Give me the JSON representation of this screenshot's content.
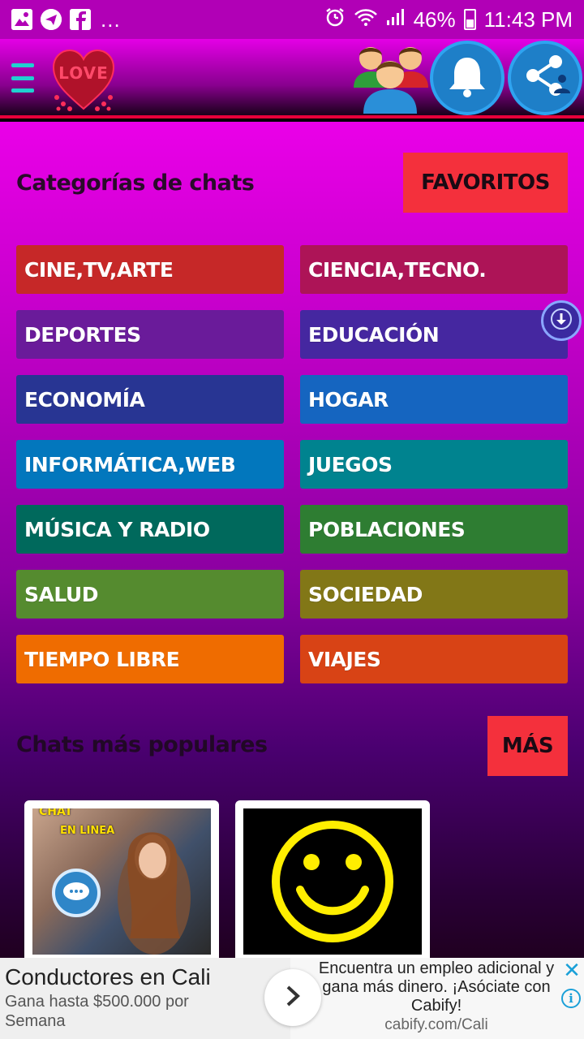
{
  "status_bar": {
    "icons_left": [
      "gallery-icon",
      "telegram-icon",
      "facebook-icon"
    ],
    "more": "...",
    "battery": "46%",
    "time": "11:43 PM"
  },
  "app_bar": {
    "logo_text": "LOVE",
    "icons": [
      "menu-icon",
      "users-icon",
      "bell-icon",
      "share-icon"
    ]
  },
  "categories_section": {
    "title": "Categorías de chats",
    "favorites_label": "FAVORITOS",
    "items": [
      {
        "label": "CINE,TV,ARTE",
        "color": "#c62828"
      },
      {
        "label": "CIENCIA,TECNO.",
        "color": "#ad1457"
      },
      {
        "label": "DEPORTES",
        "color": "#6a1b9a"
      },
      {
        "label": "EDUCACIÓN",
        "color": "#4527a0"
      },
      {
        "label": "ECONOMÍA",
        "color": "#283593"
      },
      {
        "label": "HOGAR",
        "color": "#1565c0"
      },
      {
        "label": "INFORMÁTICA,WEB",
        "color": "#0277bd"
      },
      {
        "label": "JUEGOS",
        "color": "#00838f"
      },
      {
        "label": "MÚSICA Y RADIO",
        "color": "#00695c"
      },
      {
        "label": "POBLACIONES",
        "color": "#2e7d32"
      },
      {
        "label": "SALUD",
        "color": "#558b2f"
      },
      {
        "label": "SOCIEDAD",
        "color": "#827717"
      },
      {
        "label": "TIEMPO LIBRE",
        "color": "#ef6c00"
      },
      {
        "label": "VIAJES",
        "color": "#d84315"
      }
    ]
  },
  "popular_section": {
    "title": "Chats más populares",
    "more_label": "MÁS",
    "thumb1_labels": [
      "CHAT",
      "EN LINEA"
    ]
  },
  "ad": {
    "title": "Conductores en Cali",
    "subtitle": "Gana hasta $500.000 por Semana",
    "description": "Encuentra un empleo adicional y gana más dinero. ¡Asóciate con Cabify!",
    "url": "cabify.com/Cali",
    "close": "✕",
    "info": "i"
  }
}
